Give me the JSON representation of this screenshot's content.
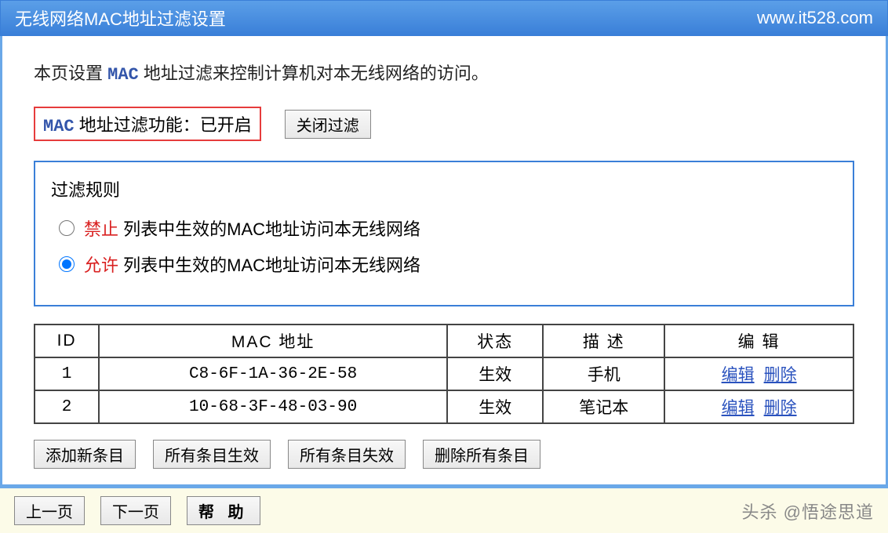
{
  "header": {
    "title": "无线网络MAC地址过滤设置",
    "site": "www.it528.com"
  },
  "intro": {
    "prefix": "本页设置 ",
    "mac": "MAC",
    "suffix": " 地址过滤来控制计算机对本无线网络的访问。"
  },
  "status": {
    "mac": "MAC",
    "label": " 地址过滤功能：已开启",
    "toggle_btn": "关闭过滤"
  },
  "rules": {
    "title": "过滤规则",
    "deny": {
      "key": "禁止",
      "text": " 列表中生效的MAC地址访问本无线网络"
    },
    "allow": {
      "key": "允许",
      "text": " 列表中生效的MAC地址访问本无线网络"
    }
  },
  "table": {
    "headers": {
      "id": "ID",
      "mac": "MAC 地址",
      "status": "状态",
      "desc": "描 述",
      "edit": "编 辑"
    },
    "rows": [
      {
        "id": "1",
        "mac": "C8-6F-1A-36-2E-58",
        "status": "生效",
        "desc": "手机"
      },
      {
        "id": "2",
        "mac": "10-68-3F-48-03-90",
        "status": "生效",
        "desc": "笔记本"
      }
    ],
    "edit_label": "编辑",
    "delete_label": "删除"
  },
  "actions": {
    "add": "添加新条目",
    "enable_all": "所有条目生效",
    "disable_all": "所有条目失效",
    "delete_all": "删除所有条目"
  },
  "footer": {
    "prev": "上一页",
    "next": "下一页",
    "help": "帮 助",
    "watermark": "头杀 @悟途思道"
  }
}
